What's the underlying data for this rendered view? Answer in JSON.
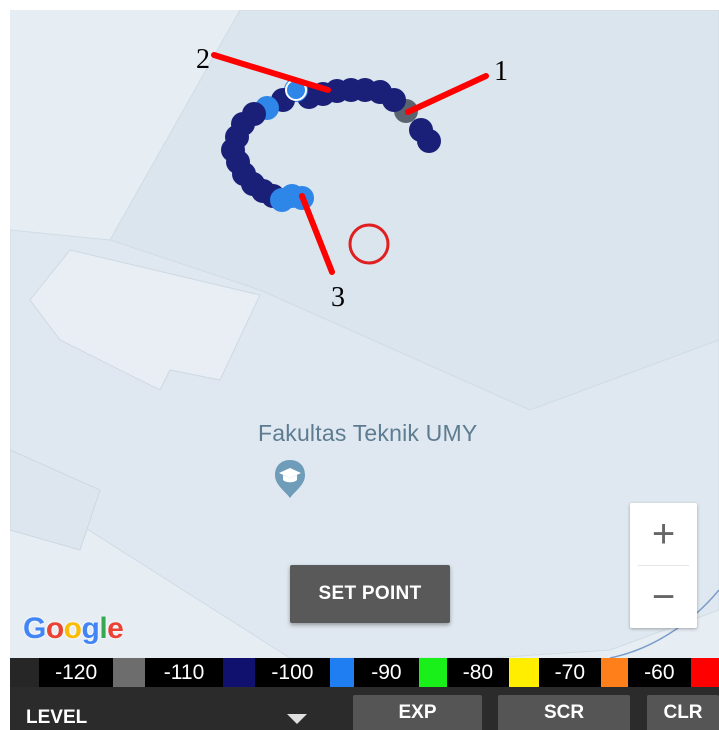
{
  "map": {
    "poi_label": "Fakultas Teknik UMY",
    "poi_icon": "graduation-cap-icon",
    "track_colors": {
      "dark_blue": "#1a1f78",
      "light_blue": "#2e86e8",
      "gray": "#5a6470"
    },
    "callouts": [
      {
        "label": "1"
      },
      {
        "label": "2"
      },
      {
        "label": "3"
      }
    ],
    "callout_color": "#ff0000",
    "target_color": "#e02020"
  },
  "zoom": {
    "in_label": "+",
    "out_label": "−"
  },
  "set_point_label": "SET POINT",
  "google_logo": {
    "letters": [
      "G",
      "o",
      "o",
      "g",
      "l",
      "e"
    ],
    "colors": [
      "#4285f4",
      "#ea4335",
      "#fbbc05",
      "#4285f4",
      "#34a853",
      "#ea4335"
    ]
  },
  "legend": [
    {
      "color": "#262626",
      "label": "-120"
    },
    {
      "color": "#6d6d6d",
      "label": "-110"
    },
    {
      "color": "#10106e",
      "label": "-100"
    },
    {
      "color": "#1f7ef2",
      "label": "-90"
    },
    {
      "color": "#19f019",
      "label": "-80"
    },
    {
      "color": "#ffee00",
      "label": "-70"
    },
    {
      "color": "#ff7f1a",
      "label": "-60"
    },
    {
      "color": "#ff0000",
      "label": ""
    }
  ],
  "bottom_bar": {
    "level_label": "LEVEL",
    "buttons": [
      {
        "label": "EXP"
      },
      {
        "label": "SCR"
      },
      {
        "label": "CLR"
      }
    ]
  }
}
